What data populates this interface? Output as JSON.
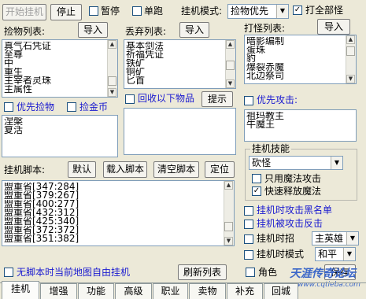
{
  "toolbar": {
    "start_label": "开始挂机",
    "stop_label": "停止",
    "pause_label": "暂停",
    "solo_label": "单跑",
    "mode_label": "挂机模式:",
    "mode_value": "捡物优先",
    "attack_all_label": "打全部怪"
  },
  "pick_list": {
    "title": "捡物列表:",
    "import_label": "导入",
    "items": [
      "真气石凭证",
      "至尊",
      "中",
      "重生",
      "主宰者灵珠",
      "主属性"
    ]
  },
  "discard_list": {
    "title": "丢弃列表:",
    "import_label": "导入",
    "items": [
      "基本剑法",
      "祈福凭证",
      "铁矿",
      "铜矿",
      "匕首"
    ]
  },
  "monster_list": {
    "title": "打怪列表:",
    "import_label": "导入",
    "items": [
      "暗影编制",
      "蛋珠",
      "豹",
      "爆裂赤魔",
      "北边祭司"
    ]
  },
  "pick_options": {
    "priority_pick_label": "优先捡物",
    "pick_gold_label": "捡金币"
  },
  "recycle": {
    "label": "回收以下物品",
    "tip_label": "提示"
  },
  "priority_attack": {
    "label": "优先攻击:",
    "items": [
      "祖玛教主",
      "牛魔王"
    ]
  },
  "extra_list": {
    "items": [
      "涅槃",
      "复活"
    ]
  },
  "script": {
    "title": "挂机脚本:",
    "default_label": "默认",
    "load_label": "载入脚本",
    "clear_label": "清空脚本",
    "locate_label": "定位",
    "lines": [
      "盟重省[347:284]",
      "盟重省[379:267]",
      "盟重省[400:277]",
      "盟重省[432:312]",
      "盟重省[425:340]",
      "盟重省[372:372]",
      "盟重省[351:382]"
    ]
  },
  "skills": {
    "title": "挂机技能",
    "skill_value": "砍怪",
    "magic_only_label": "只用魔法攻击",
    "fast_cast_label": "快速释放魔法"
  },
  "right_options": {
    "blacklist_label": "挂机时攻击黑名单",
    "counter_label": "挂机被攻击反击",
    "recruit_label": "挂机时招",
    "recruit_value": "主英雄",
    "mode_label": "挂机时模式",
    "mode_value": "和平"
  },
  "bottom": {
    "free_map_label": "无脚本时当前地图自由挂机",
    "refresh_label": "刷新列表",
    "role_label": "角色",
    "save_label": "保存"
  },
  "tabs": [
    "挂机",
    "增强",
    "功能",
    "高级",
    "职业",
    "卖物",
    "补充",
    "回城"
  ],
  "watermark": "天涯传奇论坛",
  "watermark_url": "www.cqtieba.com"
}
